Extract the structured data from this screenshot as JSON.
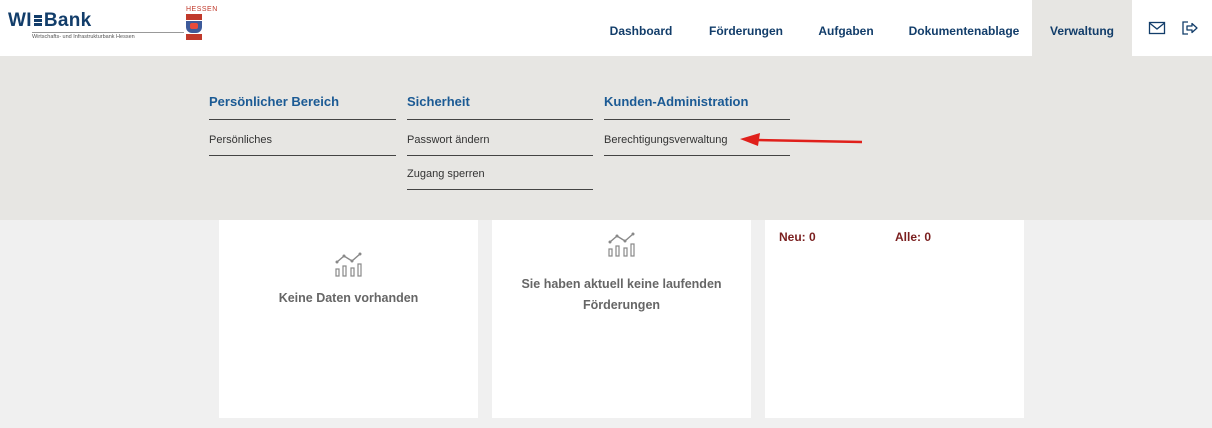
{
  "brand": {
    "logo_text": "WI",
    "logo_text2": "Bank",
    "logo_subtitle": "Wirtschafts- und Infrastrukturbank Hessen",
    "state_label": "HESSEN"
  },
  "nav": {
    "items": [
      {
        "label": "Dashboard"
      },
      {
        "label": "Förderungen"
      },
      {
        "label": "Aufgaben"
      },
      {
        "label": "Dokumentenablage"
      },
      {
        "label": "Verwaltung"
      }
    ]
  },
  "menu": {
    "columns": [
      {
        "title": "Persönlicher Bereich",
        "links": [
          "Persönliches"
        ]
      },
      {
        "title": "Sicherheit",
        "links": [
          "Passwort ändern",
          "Zugang sperren"
        ]
      },
      {
        "title": "Kunden-Administration",
        "links": [
          "Berechtigungsverwaltung"
        ]
      }
    ]
  },
  "cards": {
    "card1_text": "Keine Daten vorhanden",
    "card2_line1": "Sie haben aktuell keine laufenden",
    "card2_line2": "Förderungen",
    "new_label": "Neu: 0",
    "all_label": "Alle: 0"
  },
  "icons": {
    "mail": "mail-icon",
    "logout": "logout-icon",
    "chart": "chart-icon"
  },
  "colors": {
    "brand_blue": "#123d6a",
    "menu_title_blue": "#1b5a94",
    "panel_bg": "#e7e6e3",
    "arrow_red": "#e0201b",
    "stat_red": "#7a1f1f"
  }
}
